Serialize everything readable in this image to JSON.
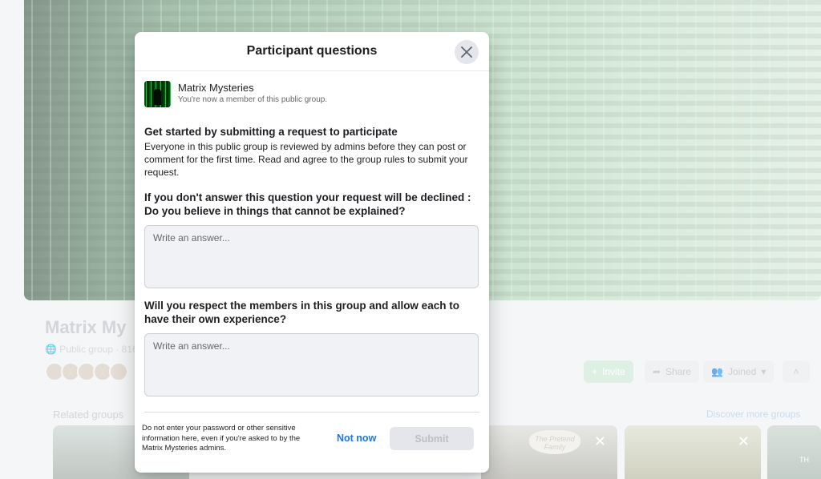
{
  "background": {
    "group_title": "Matrix My",
    "group_meta": "Public group · 816",
    "invite_label": "Invite",
    "share_label": "Share",
    "joined_label": "Joined",
    "related_label": "Related groups",
    "discover_label": "Discover more groups",
    "card_text_1": "The Pretend Family",
    "card_text_2": "TH"
  },
  "modal": {
    "title": "Participant questions",
    "close_icon": "close-icon",
    "group": {
      "name": "Matrix Mysteries",
      "subtitle": "You're now a member of this public group."
    },
    "intro": {
      "title": "Get started by submitting a request to participate",
      "body": "Everyone in this public group is reviewed by admins before they can post or comment for the first time. Read and agree to the group rules to submit your request."
    },
    "questions": [
      {
        "text": "If you don't answer this question your request will be declined : Do you believe in things that cannot be explained?",
        "placeholder": "Write an answer..."
      },
      {
        "text": "Will you respect the members in this group and allow each to have their own experience?",
        "placeholder": "Write an answer..."
      }
    ],
    "footer": {
      "note": "Do not enter your password or other sensitive information here, even if you're asked to by the Matrix Mysteries admins.",
      "not_now_label": "Not now",
      "submit_label": "Submit"
    }
  },
  "colors": {
    "accent": "#1877f2",
    "invite_green": "#42b72a",
    "disabled_button": "#e4e6eb"
  }
}
